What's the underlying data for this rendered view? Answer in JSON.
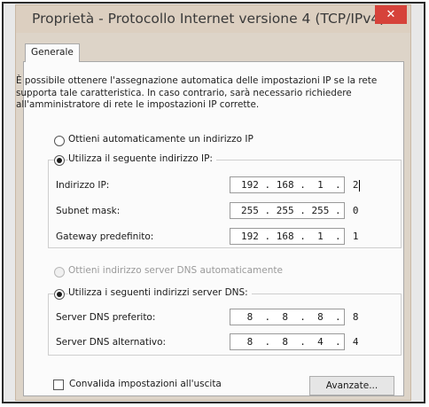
{
  "window": {
    "title": "Proprietà - Protocollo Internet versione 4 (TCP/IPv4)",
    "close_glyph": "✕"
  },
  "tabs": [
    {
      "label": "Generale"
    }
  ],
  "description": "È possibile ottenere l'assegnazione automatica delle impostazioni IP se la rete supporta tale caratteristica. In caso contrario, sarà necessario richiedere all'amministratore di rete le impostazioni IP corrette.",
  "ip_section": {
    "auto_label": "Ottieni automaticamente un indirizzo IP",
    "manual_label": "Utilizza il seguente indirizzo IP:",
    "selected": "manual",
    "fields": [
      {
        "label": "Indirizzo IP:",
        "value": "192 . 168 .  1  .  2"
      },
      {
        "label": "Subnet mask:",
        "value": "255 . 255 . 255 .  0"
      },
      {
        "label": "Gateway predefinito:",
        "value": "192 . 168 .  1  .  1"
      }
    ]
  },
  "dns_section": {
    "auto_label": "Ottieni indirizzo server DNS automaticamente",
    "manual_label": "Utilizza i seguenti indirizzi server DNS:",
    "selected": "manual",
    "fields": [
      {
        "label": "Server DNS preferito:",
        "value": " 8  .  8  .  8  .  8"
      },
      {
        "label": "Server DNS alternativo:",
        "value": " 8  .  8  .  4  .  4"
      }
    ]
  },
  "footer": {
    "validate_label": "Convalida impostazioni all'uscita",
    "validate_checked": false,
    "advanced_button": "Avanzate..."
  }
}
